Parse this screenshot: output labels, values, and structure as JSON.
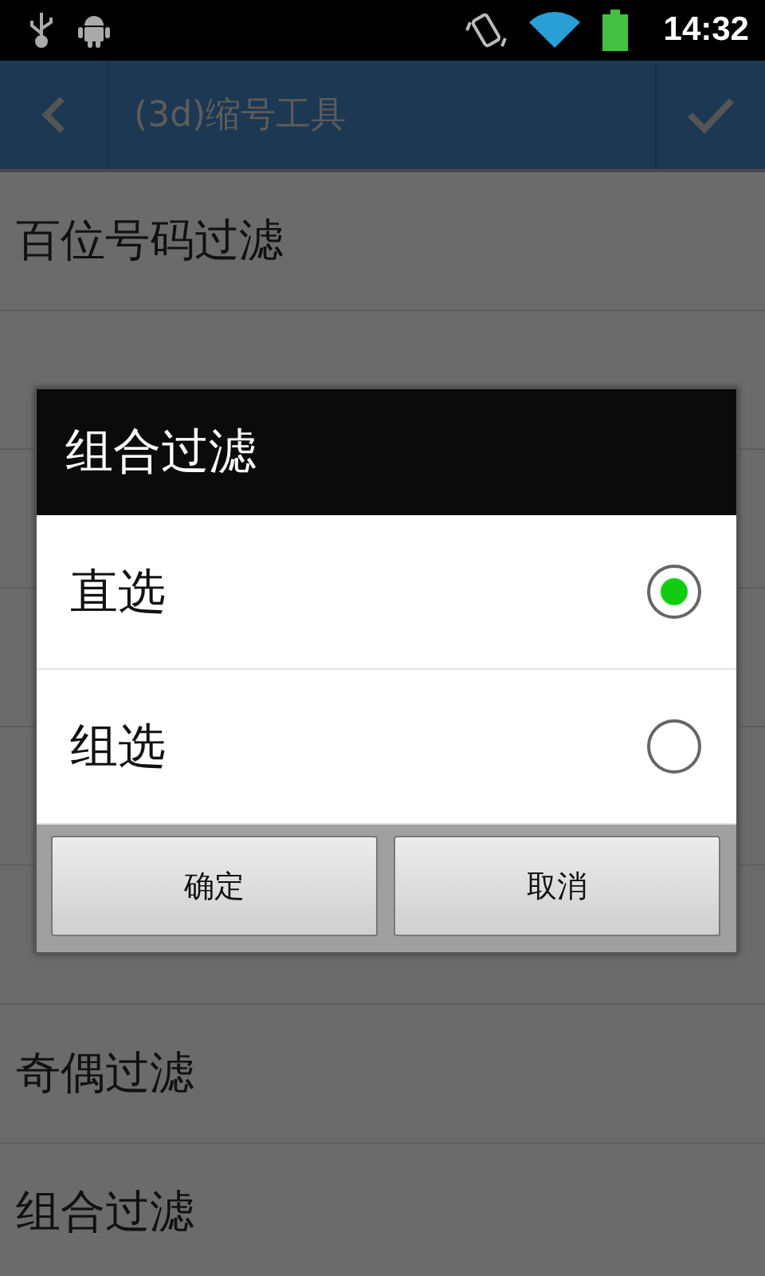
{
  "status_bar": {
    "time": "14:32"
  },
  "action_bar": {
    "title": "(3d)缩号工具"
  },
  "list": [
    {
      "kind": "item",
      "label": "百位号码过滤"
    },
    {
      "kind": "covered"
    },
    {
      "kind": "covered"
    },
    {
      "kind": "covered"
    },
    {
      "kind": "covered"
    },
    {
      "kind": "covered"
    },
    {
      "kind": "item",
      "label": "奇偶过滤"
    },
    {
      "kind": "item",
      "label": "组合过滤"
    }
  ],
  "dialog": {
    "title": "组合过滤",
    "options": [
      {
        "label": "直选",
        "selected": true
      },
      {
        "label": "组选",
        "selected": false
      }
    ],
    "buttons": [
      "确定",
      "取消"
    ]
  }
}
